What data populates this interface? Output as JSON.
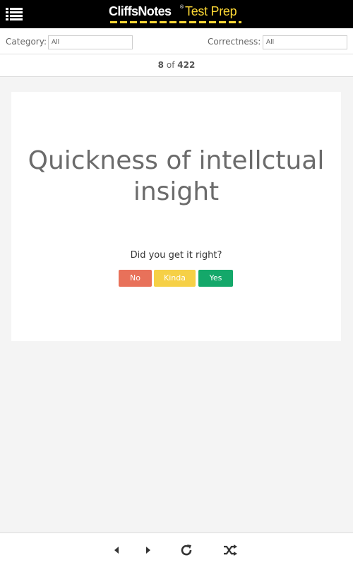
{
  "header": {
    "brand": "CliffsNotes",
    "registered": "®",
    "product": "Test Prep",
    "icons": {
      "menu": "list-menu-icon"
    },
    "colors": {
      "background": "#000000",
      "accent": "#fdd835"
    }
  },
  "filters": {
    "category_label": "Category:",
    "category_value": "All",
    "correctness_label": "Correctness:",
    "correctness_value": "All"
  },
  "counter": {
    "current": "8",
    "of": "of",
    "total": "422"
  },
  "card": {
    "term": "Quickness of intellctual insight",
    "prompt": "Did you get it right?",
    "buttons": {
      "no": "No",
      "kinda": "Kinda",
      "yes": "Yes"
    },
    "colors": {
      "no": "#e8715a",
      "kinda": "#f6d046",
      "yes": "#14a86a"
    }
  },
  "bottom_nav": {
    "icons": [
      "triangle-left-icon",
      "triangle-right-icon",
      "refresh-icon",
      "shuffle-icon"
    ]
  }
}
